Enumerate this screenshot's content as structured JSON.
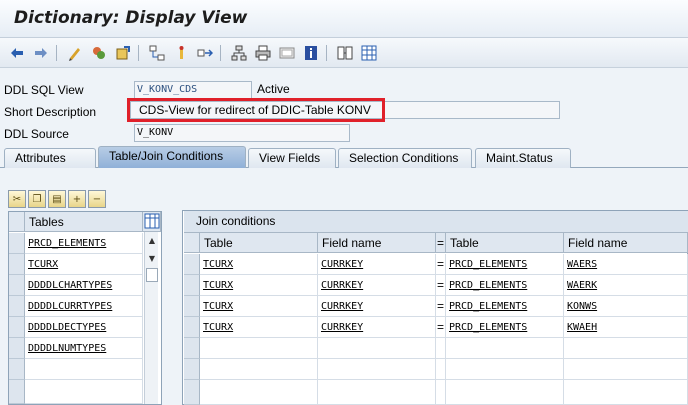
{
  "window": {
    "title": "Dictionary: Display View"
  },
  "toolbar": {
    "icons": [
      "back-arrow-icon",
      "forward-arrow-icon",
      "display-change-icon",
      "check-icon",
      "activate-icon",
      "where-used-icon",
      "object-list-icon",
      "navigate-icon",
      "hierarchy-icon",
      "print-icon",
      "frame-icon",
      "info-icon",
      "technical-settings-icon",
      "table-icon"
    ]
  },
  "form": {
    "ddl_sql_view": {
      "label": "DDL SQL View",
      "value": "V_KONV_CDS",
      "status": "Active"
    },
    "short_description": {
      "label": "Short Description",
      "value": "CDS-View for redirect of DDIC-Table KONV"
    },
    "ddl_source": {
      "label": "DDL Source",
      "value": "V_KONV"
    }
  },
  "tabs": [
    {
      "label": "Attributes",
      "active": false
    },
    {
      "label": "Table/Join Conditions",
      "active": true
    },
    {
      "label": "View Fields",
      "active": false
    },
    {
      "label": "Selection Conditions",
      "active": false
    },
    {
      "label": "Maint.Status",
      "active": false
    }
  ],
  "tables_grid": {
    "header": "Tables",
    "rows": [
      "PRCD_ELEMENTS",
      "TCURX",
      "DDDDLCHARTYPES",
      "DDDDLCURRTYPES",
      "DDDDLDECTYPES",
      "DDDDLNUMTYPES"
    ]
  },
  "join_conditions": {
    "title": "Join conditions",
    "headers": {
      "table": "Table",
      "field": "Field name",
      "eq": "=",
      "table2": "Table",
      "field2": "Field name"
    },
    "rows": [
      {
        "table": "TCURX",
        "field": "CURRKEY",
        "eq": "=",
        "table2": "PRCD_ELEMENTS",
        "field2": "WAERS"
      },
      {
        "table": "TCURX",
        "field": "CURRKEY",
        "eq": "=",
        "table2": "PRCD_ELEMENTS",
        "field2": "WAERK"
      },
      {
        "table": "TCURX",
        "field": "CURRKEY",
        "eq": "=",
        "table2": "PRCD_ELEMENTS",
        "field2": "KONWS"
      },
      {
        "table": "TCURX",
        "field": "CURRKEY",
        "eq": "=",
        "table2": "PRCD_ELEMENTS",
        "field2": "KWAEH"
      }
    ]
  },
  "colors": {
    "highlight": "#e0202a",
    "active_tab": "#9db9dc"
  }
}
